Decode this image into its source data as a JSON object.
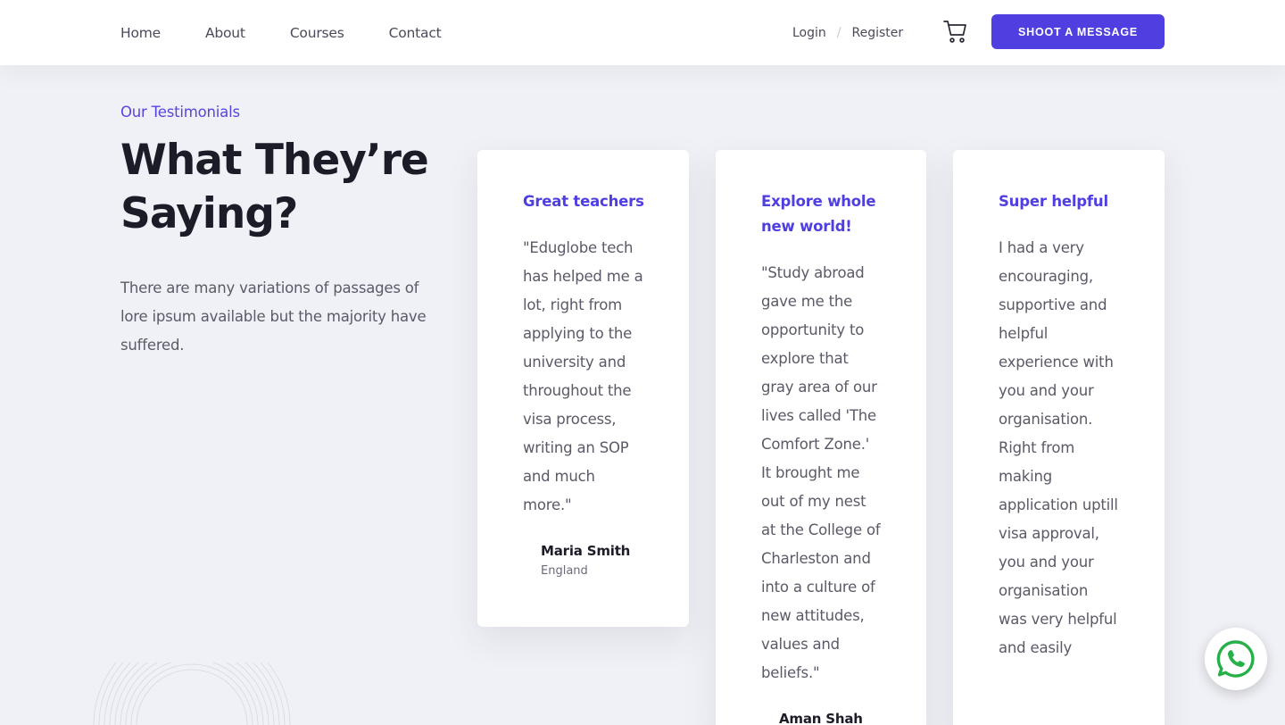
{
  "nav": {
    "links": [
      "Home",
      "About",
      "Courses",
      "Contact"
    ],
    "login": "Login",
    "separator": "/",
    "register": "Register",
    "cta": "SHOOT A MESSAGE",
    "cart_icon": "cart-icon"
  },
  "hero": {
    "eyebrow": "Our Testimonials",
    "headline_line1": "What They’re",
    "headline_line2": "Saying?",
    "intro": "There are many variations of passages of lore ipsum available but the majority have suffered."
  },
  "testimonials": [
    {
      "title": "Great teachers",
      "quote": "\"Eduglobe tech has helped me a lot, right from applying to the university and throughout the visa process, writing an SOP and much more.\"",
      "name": "Maria Smith",
      "country": "England"
    },
    {
      "title": "Explore whole new world!",
      "quote": "\"Study abroad gave me the opportunity to explore that gray area of our lives called 'The Comfort Zone.' It brought me out of my nest at the College of Charleston and into a culture of new attitudes, values and beliefs.\"",
      "name": "Aman Shah",
      "country": ""
    },
    {
      "title": "Super helpful",
      "quote": "I had a very encouraging, supportive and helpful experience with you and your organisation. Right from making application uptill visa approval, you and your organisation was very helpful and easily",
      "name": "",
      "country": ""
    }
  ],
  "colors": {
    "accent": "#4f3fe0",
    "background": "#f0f1f6",
    "whatsapp": "#25b04a"
  },
  "floating": {
    "whatsapp_icon": "whatsapp-icon"
  }
}
